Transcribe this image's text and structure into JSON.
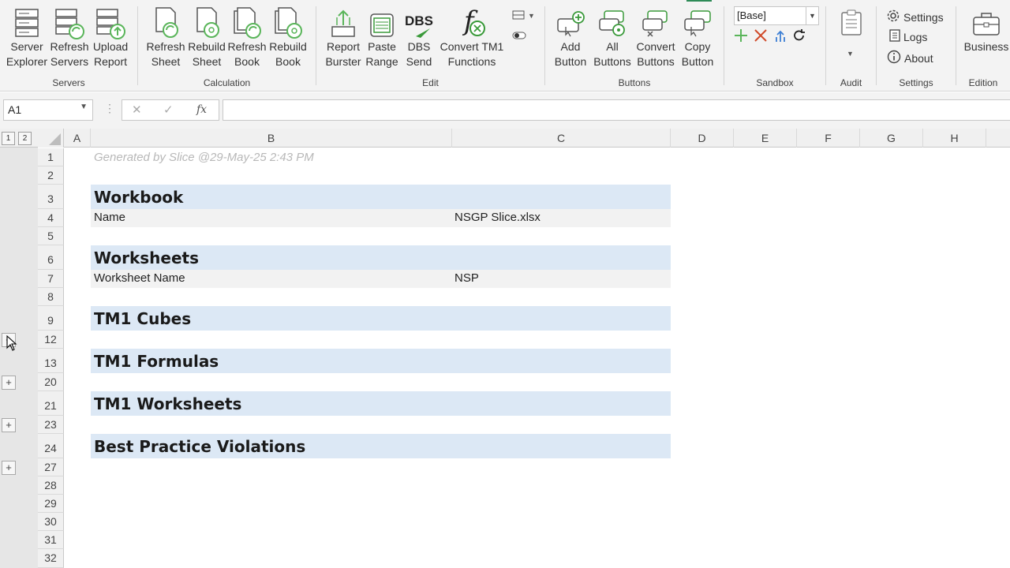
{
  "ribbon": {
    "groups": {
      "servers": "Servers",
      "calculation": "Calculation",
      "edit": "Edit",
      "buttons": "Buttons",
      "sandbox": "Sandbox",
      "audit": "Audit",
      "settings": "Settings",
      "edition": "Edition"
    },
    "buttons": {
      "server_explorer": "Server\nExplorer",
      "refresh_servers": "Refresh\nServers",
      "upload_report": "Upload\nReport",
      "refresh_sheet": "Refresh\nSheet",
      "rebuild_sheet": "Rebuild\nSheet",
      "refresh_book": "Refresh\nBook",
      "rebuild_book": "Rebuild\nBook",
      "report_burster": "Report\nBurster",
      "paste_range": "Paste\nRange",
      "dbs_send": "DBS\nSend",
      "dbs_icon_text": "DBS",
      "convert_tm1": "Convert TM1\nFunctions",
      "add_button": "Add\nButton",
      "all_buttons": "All\nButtons",
      "convert_buttons": "Convert\nButtons",
      "copy_button": "Copy\nButton",
      "business": "Business"
    },
    "sandbox_value": "[Base]",
    "settings_items": {
      "settings": "Settings",
      "logs": "Logs",
      "about": "About"
    }
  },
  "formula_bar": {
    "name_box": "A1",
    "fx_symbol": "fx",
    "formula": ""
  },
  "columns": [
    "A",
    "B",
    "C",
    "D",
    "E",
    "F",
    "G",
    "H"
  ],
  "rows": [
    "1",
    "2",
    "3",
    "4",
    "5",
    "6",
    "7",
    "8",
    "9",
    "12",
    "13",
    "20",
    "21",
    "23",
    "24",
    "27",
    "28",
    "29",
    "30",
    "31",
    "32"
  ],
  "outline_levels": [
    "1",
    "2"
  ],
  "sheet": {
    "generated": "Generated by Slice @29-May-25 2:43 PM",
    "workbook_heading": "Workbook",
    "name_label": "Name",
    "name_value": "NSGP Slice.xlsx",
    "worksheets_heading": "Worksheets",
    "worksheet_name_label": "Worksheet Name",
    "worksheet_name_value": "NSP",
    "tm1_cubes_heading": "TM1 Cubes",
    "tm1_formulas_heading": "TM1 Formulas",
    "tm1_worksheets_heading": "TM1 Worksheets",
    "best_practice_heading": "Best Practice Violations"
  },
  "colors": {
    "ribbon_bg": "#f3f3f3",
    "section_band": "#dce8f5",
    "detail_band": "#f2f2f2",
    "accent_green": "#5ab55a",
    "accent_red": "#d04a2a",
    "accent_blue": "#3d7fd4"
  }
}
